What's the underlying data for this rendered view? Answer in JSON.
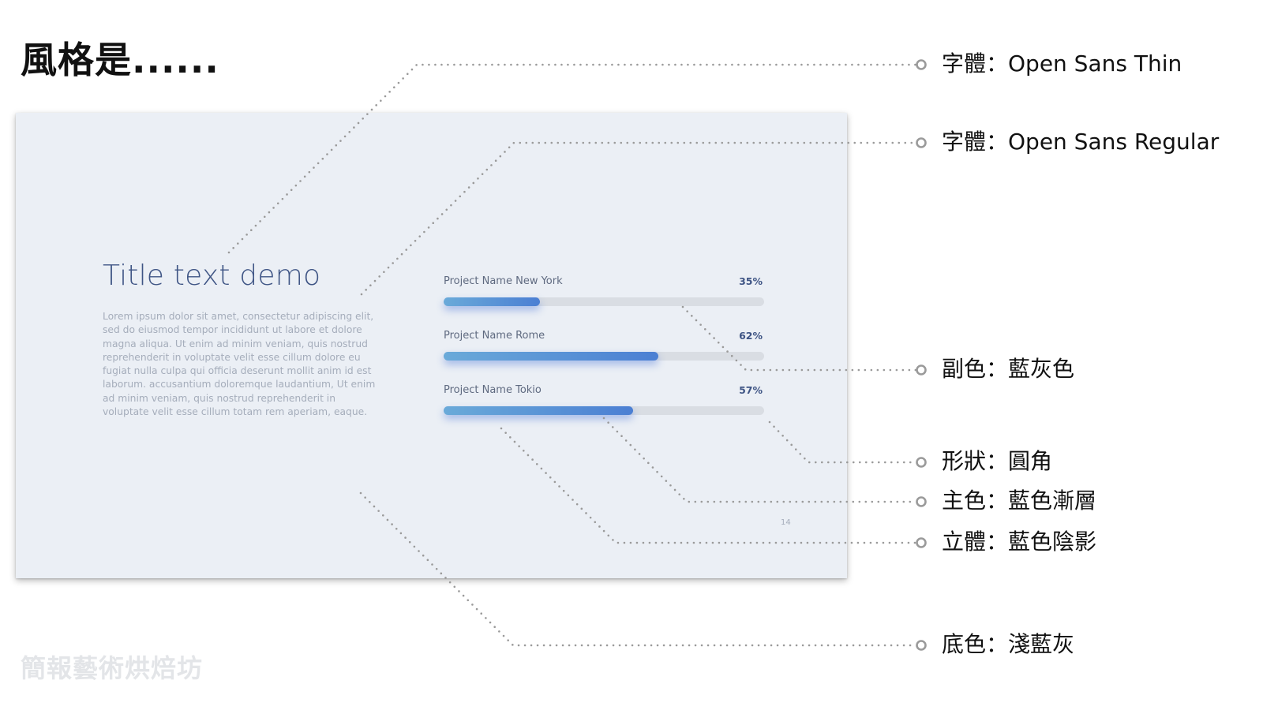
{
  "heading": "風格是......",
  "slide": {
    "title": "Title text demo",
    "body": "Lorem ipsum dolor sit amet, consectetur adipiscing elit, sed do eiusmod tempor incididunt ut labore et dolore magna aliqua. Ut enim ad minim veniam, quis nostrud reprehenderit in voluptate velit esse cillum dolore eu fugiat nulla culpa qui officia deserunt mollit anim id est laborum. accusantium doloremque laudantium, Ut enim ad minim veniam, quis nostrud reprehenderit in voluptate velit esse cillum totam rem aperiam, eaque.",
    "page_number": "14",
    "projects": [
      {
        "name": "Project Name New York",
        "percent_label": "35%",
        "progress": 0.3
      },
      {
        "name": "Project Name Rome",
        "percent_label": "62%",
        "progress": 0.67
      },
      {
        "name": "Project Name Tokio",
        "percent_label": "57%",
        "progress": 0.59
      }
    ],
    "colors": {
      "background": "#ebeff5",
      "title": "#3f5585",
      "track": "#d9dde3",
      "gradient_start": "#6aaad9",
      "gradient_end": "#4b7fd3"
    }
  },
  "annotations": [
    {
      "label": "字體：Open Sans Thin"
    },
    {
      "label": "字體：Open Sans Regular"
    },
    {
      "label": "副色：藍灰色"
    },
    {
      "label": "形狀：圓角"
    },
    {
      "label": "主色：藍色漸層"
    },
    {
      "label": "立體：藍色陰影"
    },
    {
      "label": "底色：淺藍灰"
    }
  ],
  "watermark": "簡報藝術烘焙坊",
  "leader_color": "#9a9a9a"
}
